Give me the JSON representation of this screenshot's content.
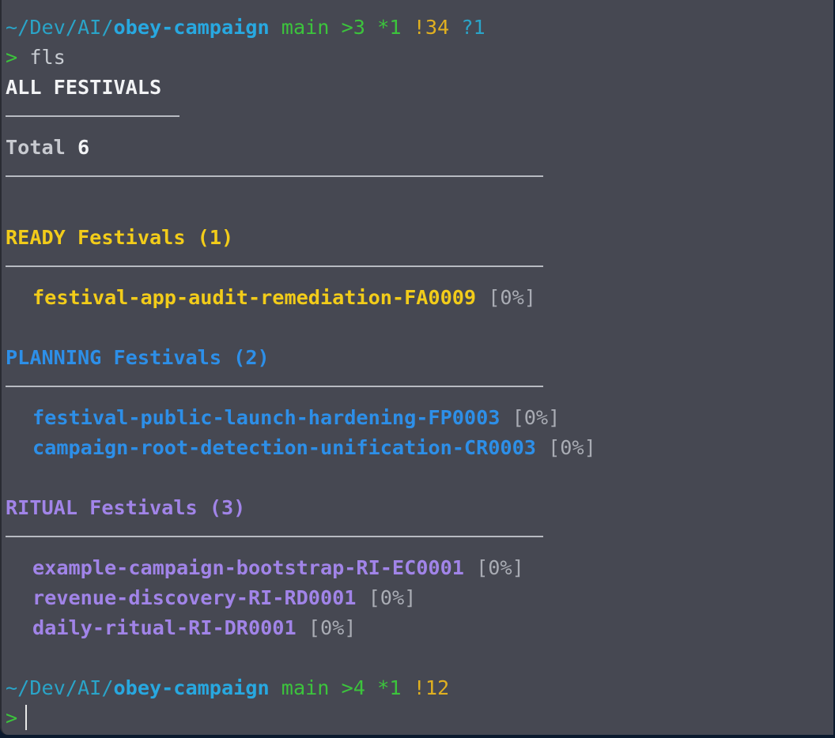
{
  "prompt1": {
    "path_prefix": "~/Dev/AI/",
    "path_dir": "obey-campaign",
    "branch": "main",
    "ahead": ">3",
    "staged": "*1",
    "modified": "!34",
    "untracked": "?1",
    "prompt_char": ">",
    "command": "fls"
  },
  "output": {
    "heading": "ALL FESTIVALS",
    "total_label": "Total",
    "total_value": "6",
    "sections": [
      {
        "status": "READY",
        "label": "Festivals",
        "count": "(1)",
        "items": [
          {
            "name": "festival-app-audit-remediation-FA0009",
            "progress": "[0%]"
          }
        ]
      },
      {
        "status": "PLANNING",
        "label": "Festivals",
        "count": "(2)",
        "items": [
          {
            "name": "festival-public-launch-hardening-FP0003",
            "progress": "[0%]"
          },
          {
            "name": "campaign-root-detection-unification-CR0003",
            "progress": "[0%]"
          }
        ]
      },
      {
        "status": "RITUAL",
        "label": "Festivals",
        "count": "(3)",
        "items": [
          {
            "name": "example-campaign-bootstrap-RI-EC0001",
            "progress": "[0%]"
          },
          {
            "name": "revenue-discovery-RI-RD0001",
            "progress": "[0%]"
          },
          {
            "name": "daily-ritual-RI-DR0001",
            "progress": "[0%]"
          }
        ]
      }
    ]
  },
  "prompt2": {
    "path_prefix": "~/Dev/AI/",
    "path_dir": "obey-campaign",
    "branch": "main",
    "ahead": ">4",
    "staged": "*1",
    "modified": "!12",
    "prompt_char": ">"
  },
  "colors": {
    "background": "#464852",
    "path": "#28a8e0",
    "branch": "#3cc43c",
    "modified": "#e0b020",
    "ready": "#f2cc1a",
    "planning": "#2d8fe8",
    "ritual": "#a184e8"
  }
}
